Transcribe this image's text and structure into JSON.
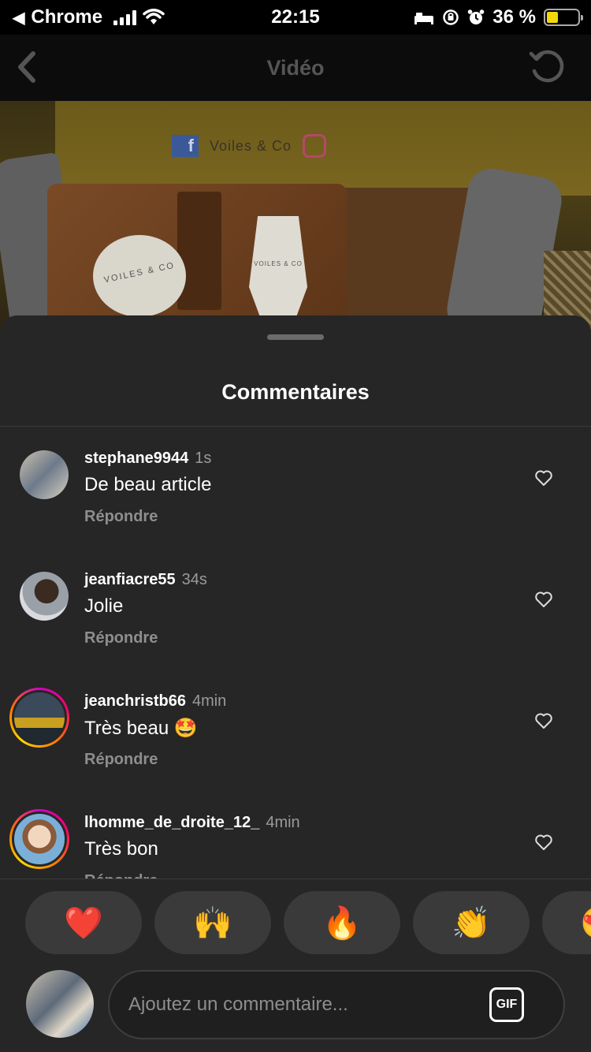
{
  "status_bar": {
    "back_app": "Chrome",
    "time": "22:15",
    "battery_pct": "36 %",
    "battery_level": 0.36
  },
  "nav": {
    "title": "Vidéo"
  },
  "video": {
    "brand_fb": "f",
    "brand_name": "Voiles & Co",
    "tag_round": "VOILES & CO",
    "tag_card": "VOILES & CO"
  },
  "sheet": {
    "title": "Commentaires",
    "reply_label": "Répondre"
  },
  "comments": [
    {
      "user": "stephane9944",
      "time": "1s",
      "text": "De beau article",
      "reply": "Répondre"
    },
    {
      "user": "jeanfiacre55",
      "time": "34s",
      "text": "Jolie",
      "reply": "Répondre"
    },
    {
      "user": "jeanchristb66",
      "time": "4min",
      "text": "Très beau 🤩",
      "reply": "Répondre"
    },
    {
      "user": "lhomme_de_droite_12_",
      "time": "4min",
      "text": "Très bon",
      "reply": "Répondre"
    }
  ],
  "emoji_bar": [
    "❤️",
    "🙌",
    "🔥",
    "👏",
    "😍"
  ],
  "composer": {
    "placeholder": "Ajoutez un commentaire...",
    "gif_label": "GIF"
  }
}
